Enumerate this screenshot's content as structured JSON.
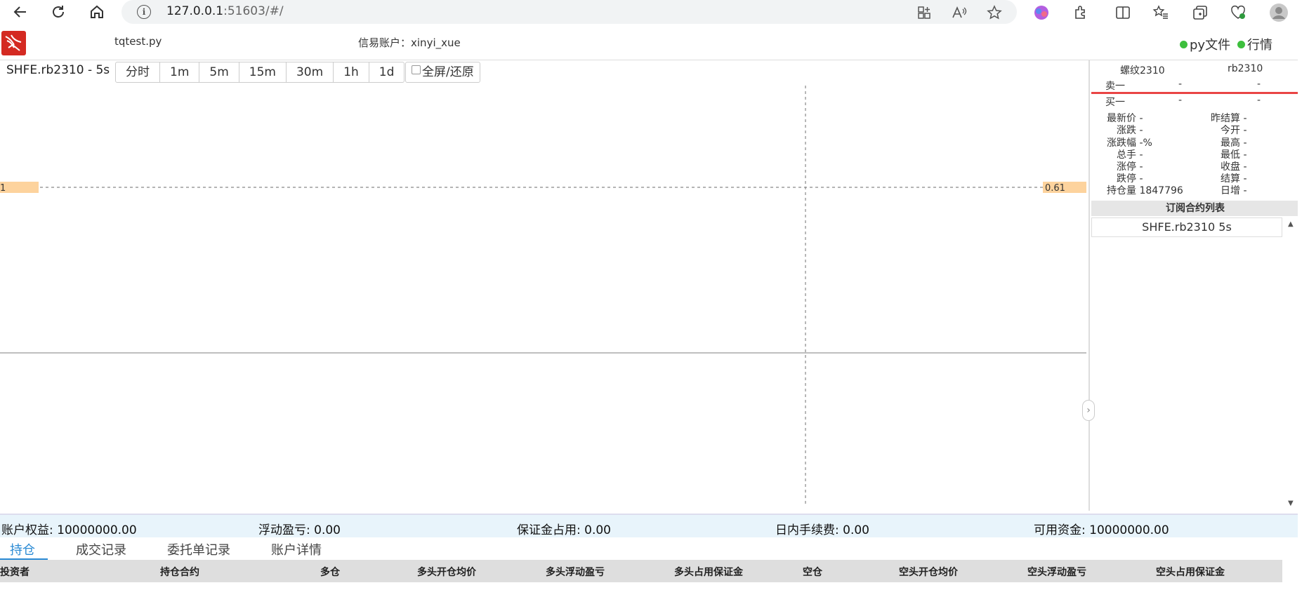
{
  "browser": {
    "url_host": "127.0.0.1",
    "url_rest": ":51603/#/"
  },
  "header": {
    "file_name": "tqtest.py",
    "account_label": "信易账户：",
    "account_name": "xinyi_xue",
    "status_py": "py文件",
    "status_quote": "行情"
  },
  "chart": {
    "symbol_title": "SHFE.rb2310 - 5s",
    "periods": [
      "分时",
      "1m",
      "5m",
      "15m",
      "30m",
      "1h",
      "1d"
    ],
    "fullscreen_label": "全屏/还原",
    "left_axis_label": "1",
    "right_axis_label": "0.61",
    "accent_color": "#fdd39d"
  },
  "quote": {
    "name": "螺纹2310",
    "code": "rb2310",
    "ask_label": "卖一",
    "ask_price": "-",
    "ask_volume": "-",
    "bid_label": "买一",
    "bid_price": "-",
    "bid_volume": "-",
    "left": [
      {
        "label": "最新价",
        "value": "-"
      },
      {
        "label": "涨跌",
        "value": "-"
      },
      {
        "label": "涨跌幅",
        "value": "-%"
      },
      {
        "label": "总手",
        "value": "-"
      },
      {
        "label": "涨停",
        "value": "-"
      },
      {
        "label": "跌停",
        "value": "-"
      },
      {
        "label": "持仓量",
        "value": "1847796"
      }
    ],
    "right": [
      {
        "label": "昨结算",
        "value": "-"
      },
      {
        "label": "今开",
        "value": "-"
      },
      {
        "label": "最高",
        "value": "-"
      },
      {
        "label": "最低",
        "value": "-"
      },
      {
        "label": "收盘",
        "value": "-"
      },
      {
        "label": "结算",
        "value": "-"
      },
      {
        "label": "日增",
        "value": "-"
      }
    ]
  },
  "subscriptions": {
    "title": "订阅合约列表",
    "items": [
      "SHFE.rb2310 5s"
    ]
  },
  "summary": {
    "equity": "账户权益: 10000000.00",
    "float_pnl": "浮动盈亏: 0.00",
    "margin": "保证金占用: 0.00",
    "fee": "日内手续费: 0.00",
    "available": "可用资金: 10000000.00"
  },
  "tabs": [
    "持仓",
    "成交记录",
    "委托单记录",
    "账户详情"
  ],
  "table": {
    "columns": [
      "投资者",
      "持仓合约",
      "多仓",
      "多头开仓均价",
      "多头浮动盈亏",
      "多头占用保证金",
      "空仓",
      "空头开仓均价",
      "空头浮动盈亏",
      "空头占用保证金"
    ]
  }
}
